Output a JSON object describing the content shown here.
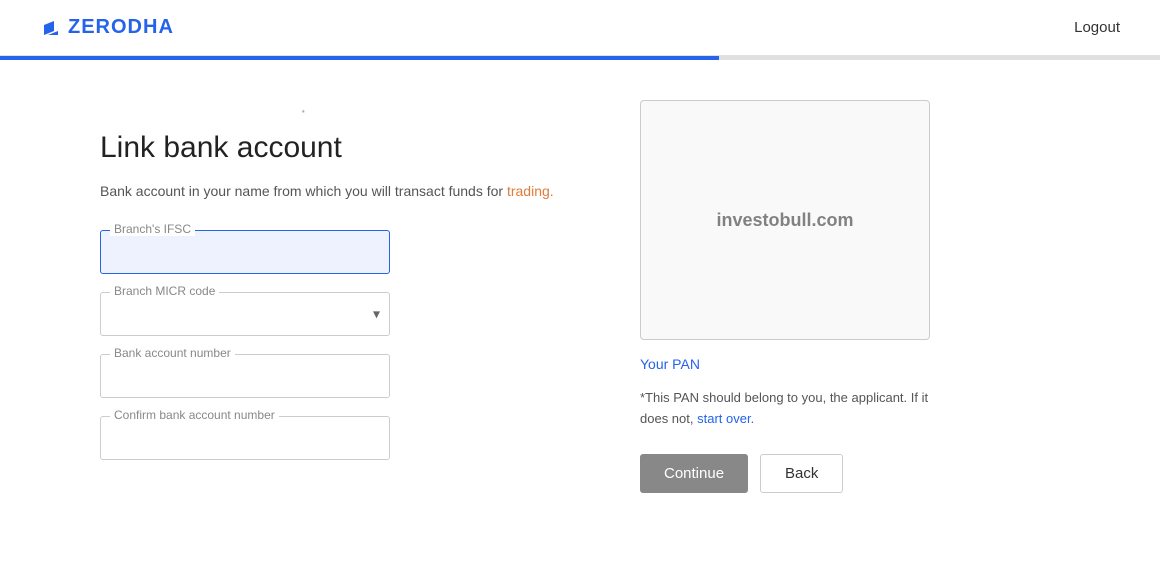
{
  "header": {
    "logo_text": "ZERODHA",
    "logout_label": "Logout"
  },
  "progress": {
    "fill_percent": "62%"
  },
  "left": {
    "dot": "·",
    "title": "Link bank account",
    "subtitle_plain": "Bank account in your name from which you will transact funds for",
    "subtitle_highlight": " trading.",
    "fields": {
      "ifsc_label": "Branch's IFSC",
      "ifsc_value": "",
      "ifsc_placeholder": "",
      "micr_label": "Branch MICR code",
      "micr_value": "",
      "bank_account_label": "Bank account number",
      "bank_account_value": "",
      "confirm_account_label": "Confirm bank account number",
      "confirm_account_value": ""
    }
  },
  "right": {
    "watermark": "investobull.com",
    "pan_label": "Your PAN",
    "pan_note_plain": "*This PAN should belong to you, the applicant. If it does not, ",
    "pan_note_link": "start over.",
    "continue_label": "Continue",
    "back_label": "Back"
  }
}
